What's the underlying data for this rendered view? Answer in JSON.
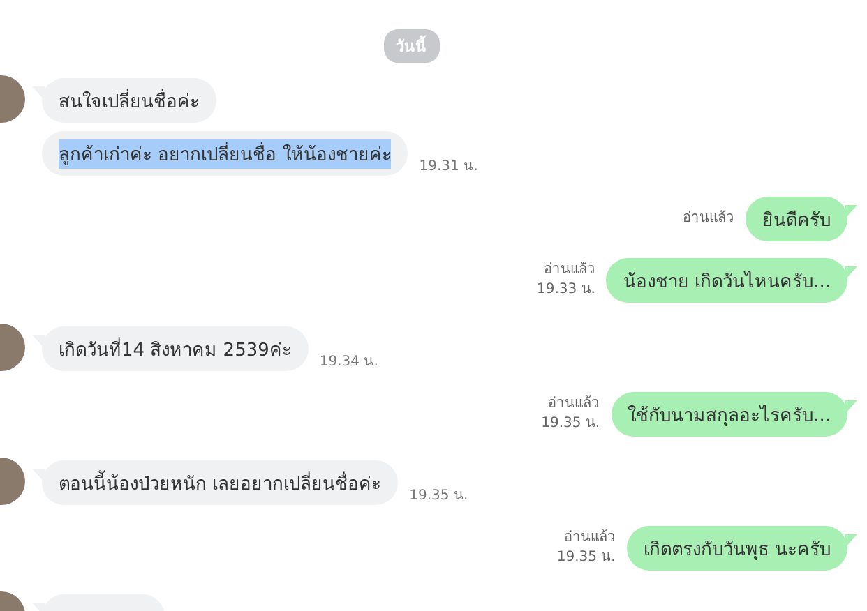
{
  "date_label": "วันนี้",
  "messages": [
    {
      "kind": "incoming",
      "avatar": true,
      "text": "สนใจเปลี่ยนชื่อค่ะ",
      "highlighted": false
    },
    {
      "kind": "incoming",
      "avatar": false,
      "text": "ลูกค้าเก่าค่ะ อยากเปลี่ยนชื่อ ให้น้องชายค่ะ",
      "highlighted": true,
      "time": "19.31 น."
    },
    {
      "kind": "outgoing",
      "text": "ยินดีครับ",
      "read": "อ่านแล้ว"
    },
    {
      "kind": "outgoing",
      "text": "น้องชาย เกิดวันไหนครับ...",
      "read": "อ่านแล้ว",
      "time": "19.33 น."
    },
    {
      "kind": "incoming",
      "avatar": true,
      "text": "เกิดวันที่14 สิงหาคม 2539ค่ะ",
      "highlighted": false,
      "time": "19.34 น."
    },
    {
      "kind": "outgoing",
      "text": "ใช้กับนามสกุลอะไรครับ...",
      "read": "อ่านแล้ว",
      "time": "19.35 น."
    },
    {
      "kind": "incoming",
      "avatar": true,
      "text": "ตอนนี้น้องป่วยหนัก เลยอยากเปลี่ยนชื่อค่ะ",
      "highlighted": false,
      "time": "19.35 น."
    },
    {
      "kind": "outgoing",
      "text": "เกิดตรงกับวันพุธ นะครับ",
      "read": "อ่านแล้ว",
      "time": "19.35 น."
    },
    {
      "kind": "incoming",
      "avatar": true
    }
  ]
}
